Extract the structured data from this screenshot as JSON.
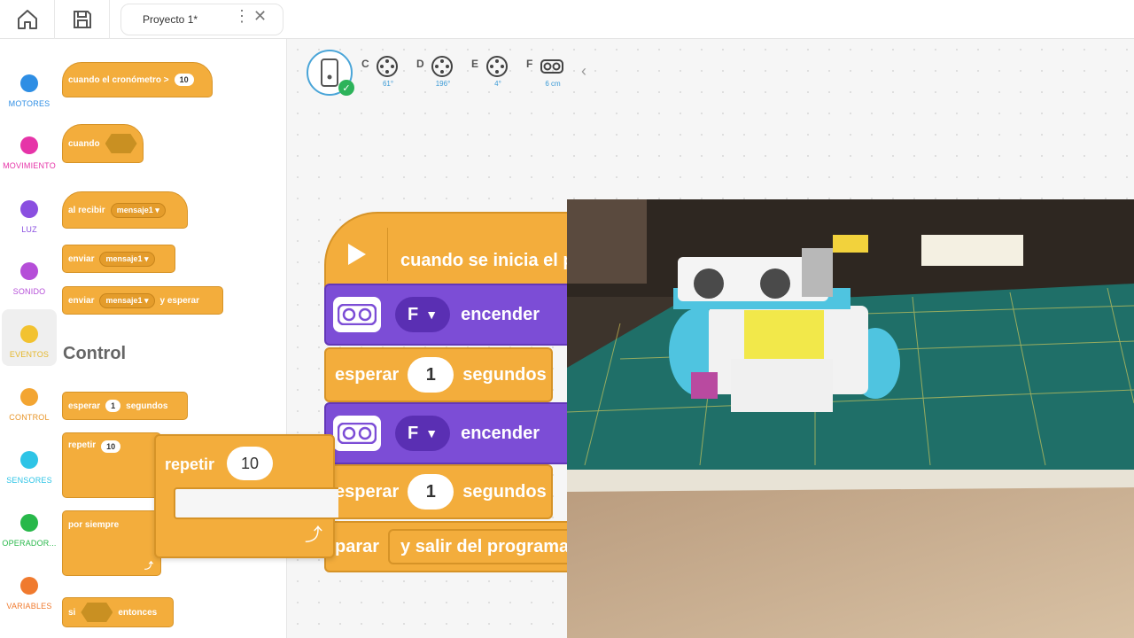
{
  "topbar": {
    "project_title": "Proyecto 1*",
    "kebab": "⋮",
    "close": "✕"
  },
  "categories": [
    {
      "label": "MOTORES",
      "color": "#2e8ee4",
      "label_color": "#2e8ee4"
    },
    {
      "label": "MOVIMIENTO",
      "color": "#e634a8",
      "label_color": "#e634a8"
    },
    {
      "label": "LUZ",
      "color": "#8a4fe0",
      "label_color": "#8a4fe0"
    },
    {
      "label": "SONIDO",
      "color": "#b54ed8",
      "label_color": "#b54ed8"
    },
    {
      "label": "EVENTOS",
      "color": "#f2c230",
      "label_color": "#e5b72a"
    },
    {
      "label": "CONTROL",
      "color": "#f3a532",
      "label_color": "#e8962a"
    },
    {
      "label": "SENSORES",
      "color": "#2ec4e6",
      "label_color": "#2ec4e6"
    },
    {
      "label": "OPERADOR...",
      "color": "#28b84a",
      "label_color": "#28b84a"
    },
    {
      "label": "VARIABLES",
      "color": "#f07a2e",
      "label_color": "#f07a2e"
    }
  ],
  "palette": {
    "timer_block": {
      "label": "cuando el cronómetro >",
      "value": "10"
    },
    "when_block": {
      "label": "cuando"
    },
    "receive_block": {
      "label": "al recibir",
      "message": "mensaje1"
    },
    "send_block": {
      "label": "enviar",
      "message": "mensaje1"
    },
    "send_wait_block": {
      "label": "enviar",
      "message": "mensaje1",
      "suffix": "y esperar"
    },
    "control_heading": "Control",
    "wait_block": {
      "label": "esperar",
      "value": "1",
      "suffix": "segundos"
    },
    "repeat_block": {
      "label": "repetir",
      "value": "10"
    },
    "forever_block": {
      "label": "por siempre"
    },
    "if_block": {
      "label": "si",
      "suffix": "entonces"
    }
  },
  "ports": [
    {
      "letter": "C",
      "value": "61°"
    },
    {
      "letter": "D",
      "value": "196°"
    },
    {
      "letter": "E",
      "value": "4°"
    },
    {
      "letter": "F",
      "value": "6 cm"
    }
  ],
  "program": {
    "start_label": "cuando se inicia el p",
    "sensor1": {
      "port": "F",
      "action": "encender"
    },
    "wait1": {
      "label": "esperar",
      "value": "1",
      "suffix": "segundos"
    },
    "sensor2": {
      "port": "F",
      "action": "encender"
    },
    "wait2": {
      "label": "esperar",
      "value": "1",
      "suffix": "segundos"
    },
    "stop": {
      "label": "parar",
      "option": "y salir del programa"
    }
  },
  "dragged_repeat": {
    "label": "repetir",
    "value": "10"
  },
  "icons": {
    "home": "home-icon",
    "save": "save-icon",
    "play": "play-icon",
    "loop": "loop-arrow-icon",
    "check": "✓",
    "collapse": "‹"
  }
}
